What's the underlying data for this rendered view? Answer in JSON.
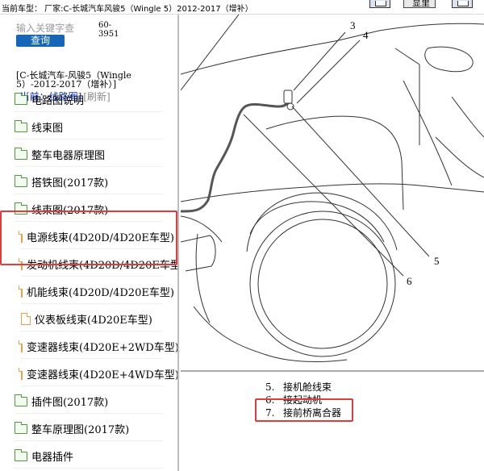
{
  "topbar": {
    "model_text": "当前车型： 厂家:C-长城汽车风骏5（Wingle 5）2012-2017（增补）",
    "button_label": "显里"
  },
  "sidebar": {
    "search_placeholder": "输入关键字查",
    "query_button": "查询",
    "count": "60-3951",
    "breadcrumb": "[C-长城汽车-风骏5（Wingle 5）-2012-2017（增补）]",
    "current_label": "[当前：线路图]",
    "refresh_label": "[刷新]",
    "items": [
      {
        "type": "folder",
        "label": "电路图说明"
      },
      {
        "type": "folder",
        "label": "线束图"
      },
      {
        "type": "folder",
        "label": "整车电器原理图"
      },
      {
        "type": "folder",
        "label": "搭铁图(2017款)"
      },
      {
        "type": "folder-open",
        "label": "线束图(2017款)"
      },
      {
        "type": "file",
        "label": "电源线束(4D20D/4D20E车型)"
      },
      {
        "type": "file",
        "label": "发动机线束(4D20D/4D20E车型"
      },
      {
        "type": "file",
        "label": "机能线束(4D20D/4D20E车型)"
      },
      {
        "type": "file",
        "label": "仪表板线束(4D20E车型)"
      },
      {
        "type": "file",
        "label": "变速器线束(4D20E+2WD车型)"
      },
      {
        "type": "file",
        "label": "变速器线束(4D20E+4WD车型)"
      },
      {
        "type": "folder",
        "label": "插件图(2017款)"
      },
      {
        "type": "folder",
        "label": "整车原理图(2017款)"
      },
      {
        "type": "folder",
        "label": "电器插件"
      }
    ]
  },
  "diagram": {
    "callouts": [
      "3",
      "4",
      "5",
      "6"
    ],
    "legend": [
      {
        "num": "5.",
        "text": "接机舱线束"
      },
      {
        "num": "6.",
        "text": "接起动机"
      },
      {
        "num": "7.",
        "text": "接前桥离合器"
      }
    ]
  },
  "colors": {
    "query_button": "#1565b8",
    "highlight": "#e33b3b",
    "folder": "#4c9a3c",
    "file": "#e3a24a",
    "current_link": "#0b2fb8"
  }
}
